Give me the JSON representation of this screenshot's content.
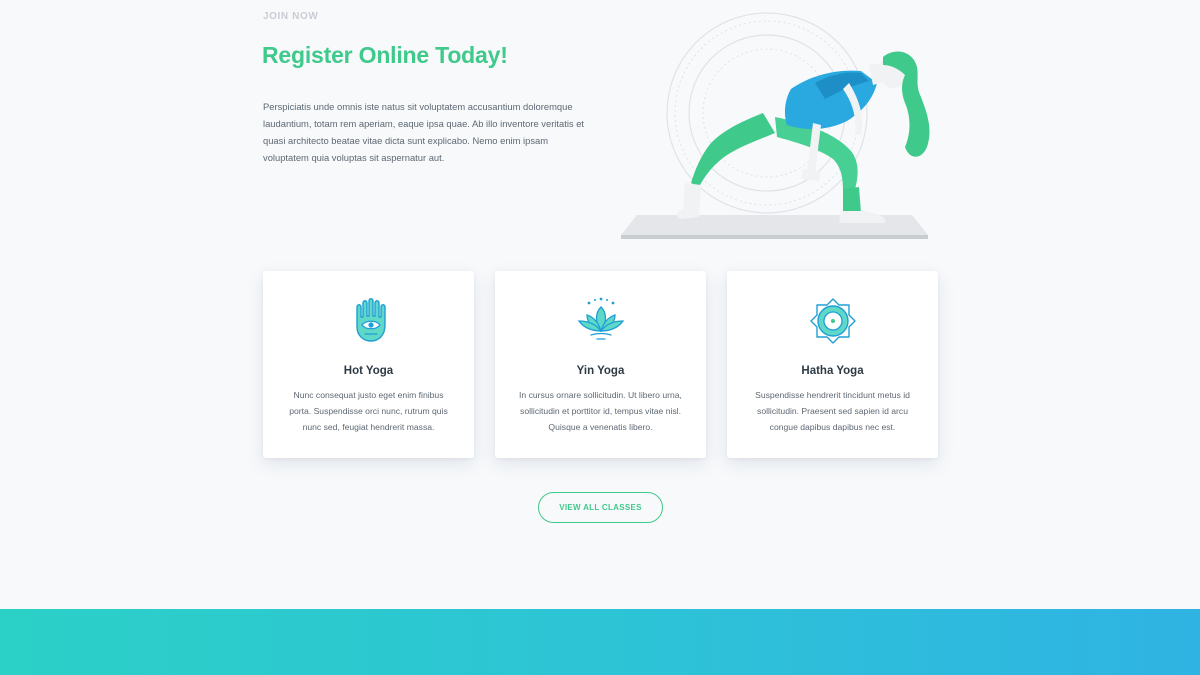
{
  "section": {
    "eyebrow": "JOIN NOW",
    "heading": "Register Online Today!",
    "intro": "Perspiciatis unde omnis iste natus sit voluptatem accusantium doloremque laudantium, totam rem aperiam, eaque ipsa quae. Ab illo inventore veritatis et quasi architecto beatae vitae dicta sunt explicabo. Nemo enim ipsam voluptatem quia voluptas sit aspernatur aut."
  },
  "colors": {
    "accent": "#3fc98b",
    "icon_fill": "#5fd8c8",
    "icon_stroke": "#1e9fd6",
    "footer_start": "#2bd0c6",
    "footer_end": "#2fb3e3"
  },
  "cards": [
    {
      "icon": "hamsa-hand-icon",
      "title": "Hot Yoga",
      "description": "Nunc consequat justo eget enim finibus porta. Suspendisse orci nunc, rutrum quis nunc sed, feugiat hendrerit massa."
    },
    {
      "icon": "lotus-icon",
      "title": "Yin Yoga",
      "description": "In cursus ornare sollicitudin. Ut libero urna, sollicitudin et porttitor id, tempus vitae nisl. Quisque a venenatis libero."
    },
    {
      "icon": "chakra-icon",
      "title": "Hatha Yoga",
      "description": "Suspendisse hendrerit tincidunt metus id sollicitudin. Praesent sed sapien id arcu congue dapibus dapibus nec est."
    }
  ],
  "cta": {
    "label": "VIEW ALL CLASSES"
  }
}
